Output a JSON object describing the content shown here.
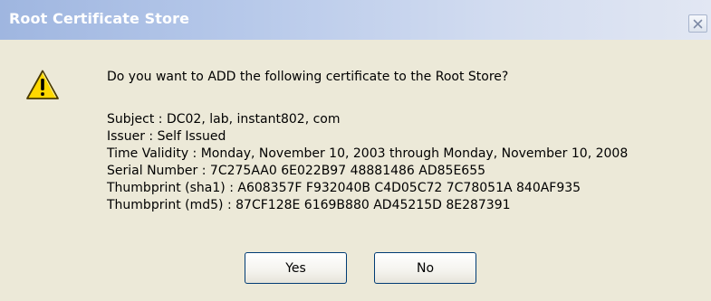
{
  "window": {
    "title": "Root Certificate Store",
    "close_icon": "close-icon"
  },
  "dialog": {
    "icon": "warning-icon",
    "question": "Do you want to ADD the following certificate to the Root Store?",
    "details": [
      "Subject : DC02, lab, instant802, com",
      "Issuer : Self Issued",
      "Time Validity : Monday, November 10, 2003 through Monday, November 10, 2008",
      "Serial Number : 7C275AA0 6E022B97 48881486 AD85E655",
      "Thumbprint (sha1) : A608357F F932040B C4D05C72 7C78051A 840AF935",
      "Thumbprint (md5) : 87CF128E 6169B880 AD45215D 8E287391"
    ]
  },
  "buttons": {
    "yes_label": "Yes",
    "no_label": "No"
  },
  "colors": {
    "dialog_background": "#ece9d8",
    "titlebar_start": "#9fb6e0",
    "titlebar_end": "#e2e7f3",
    "warning_yellow": "#ffd800"
  }
}
